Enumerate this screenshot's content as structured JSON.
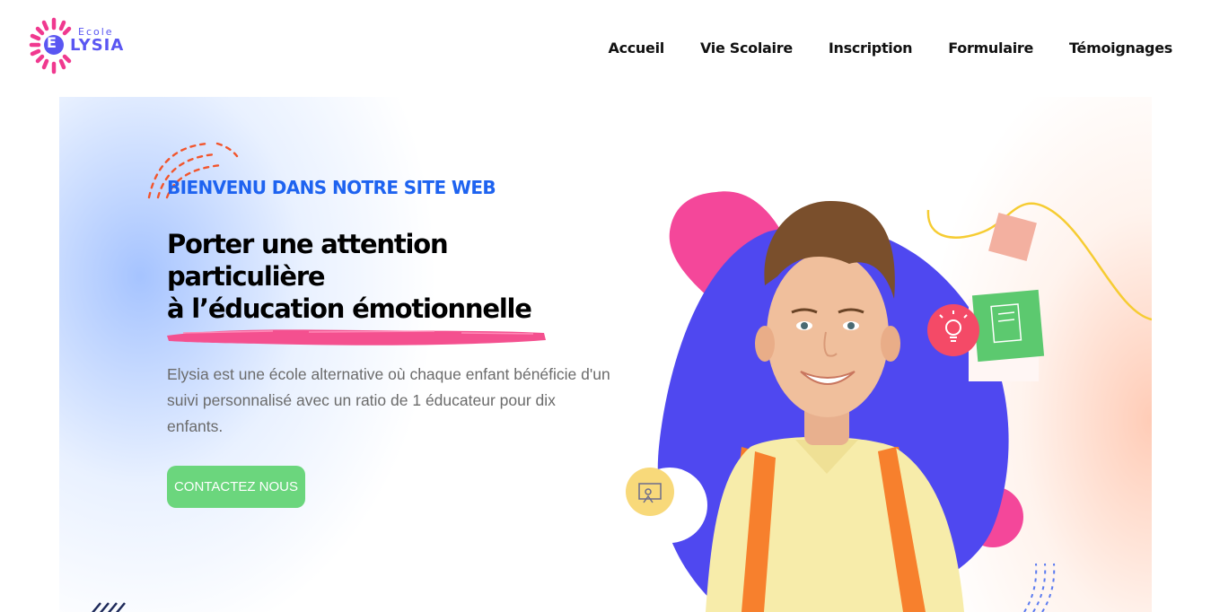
{
  "brand": {
    "small": "Ecole",
    "initial": "E",
    "rest": "LYSIA",
    "colors": {
      "primary": "#5a56f2",
      "accent": "#f0398f"
    }
  },
  "nav": {
    "items": [
      {
        "label": "Accueil"
      },
      {
        "label": "Vie Scolaire"
      },
      {
        "label": "Inscription"
      },
      {
        "label": "Formulaire"
      },
      {
        "label": "Témoignages"
      }
    ]
  },
  "hero": {
    "eyebrow": "BIENVENU DANS NOTRE SITE WEB",
    "headline": {
      "line1": "Porter une attention",
      "line2": "particulière",
      "line3": "à l’éducation émotionnelle"
    },
    "description": "Elysia est une école alternative où chaque enfant bénéficie d'un suivi personnalisé avec un ratio de 1 éducateur pour dix enfants.",
    "cta_label": "CONTACTEZ NOUS",
    "colors": {
      "eyebrow": "#1e63f0",
      "brush": "#f4508f",
      "cta": "#6bd67d",
      "blob_pink": "#f4479a",
      "blob_blue": "#4f48f0"
    },
    "icons": [
      "lightbulb-icon",
      "presentation-icon",
      "notebook-icon"
    ]
  }
}
